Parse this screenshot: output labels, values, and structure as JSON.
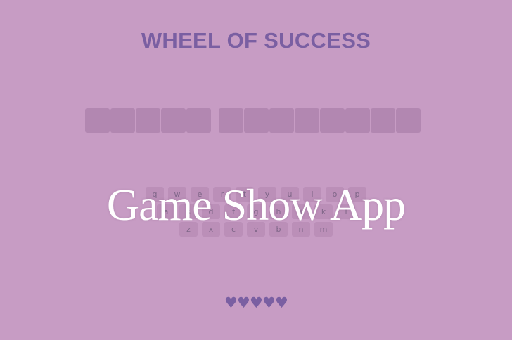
{
  "title": "WHEEL OF SUCCESS",
  "overlay_text": "Game Show App",
  "phrase": {
    "words": [
      5,
      8
    ]
  },
  "keyboard": {
    "rows": [
      [
        "q",
        "w",
        "e",
        "r",
        "t",
        "y",
        "u",
        "i",
        "o",
        "p"
      ],
      [
        "a",
        "s",
        "d",
        "f",
        "g",
        "h",
        "j",
        "k",
        "l"
      ],
      [
        "z",
        "x",
        "c",
        "v",
        "b",
        "n",
        "m"
      ]
    ]
  },
  "lives": {
    "remaining": 5,
    "heart_icon": "♥"
  },
  "colors": {
    "background": "#c79cc4",
    "accent": "#7a5fa2",
    "tile": "#b287b1",
    "key": "#bb8fb8"
  }
}
